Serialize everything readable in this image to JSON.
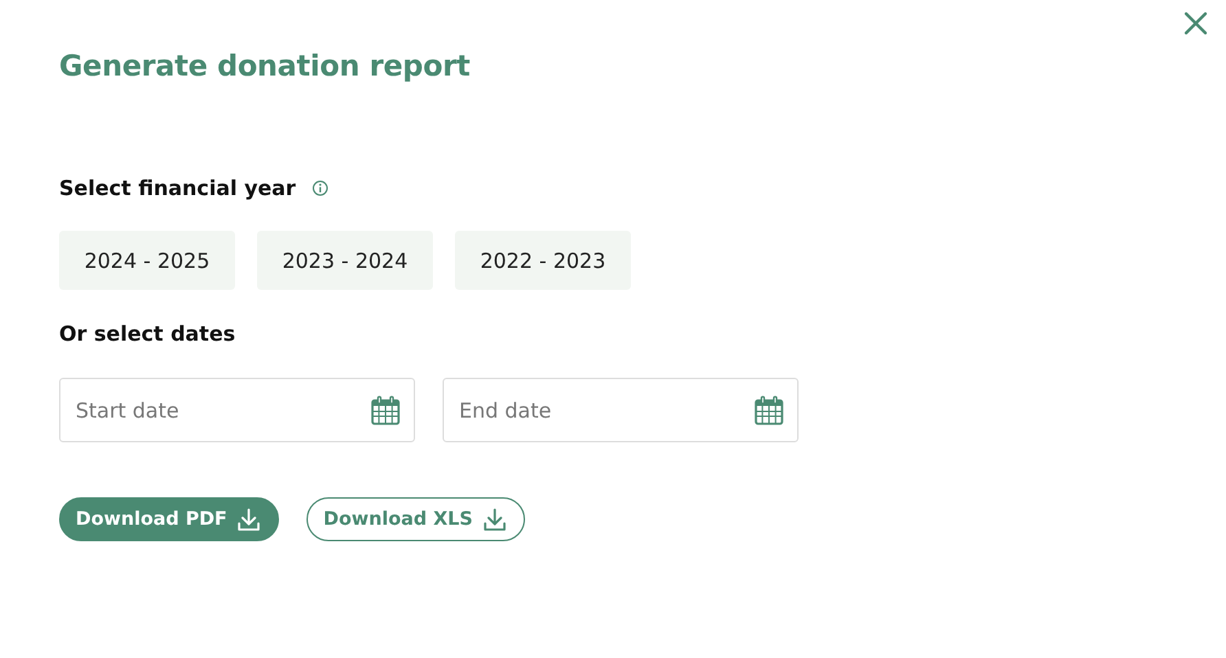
{
  "dialog": {
    "title": "Generate donation report"
  },
  "financial_year": {
    "label": "Select financial year",
    "options": [
      {
        "label": "2024 - 2025",
        "selected": false
      },
      {
        "label": "2023 - 2024",
        "selected": false
      },
      {
        "label": "2022 - 2023",
        "selected": false
      }
    ]
  },
  "dates": {
    "label": "Or select dates",
    "fields": [
      {
        "placeholder": "Start date"
      },
      {
        "placeholder": "End date"
      }
    ]
  },
  "buttons": [
    {
      "label": "Download PDF",
      "kind": "primary"
    },
    {
      "label": "Download XLS",
      "kind": "outline"
    }
  ]
}
